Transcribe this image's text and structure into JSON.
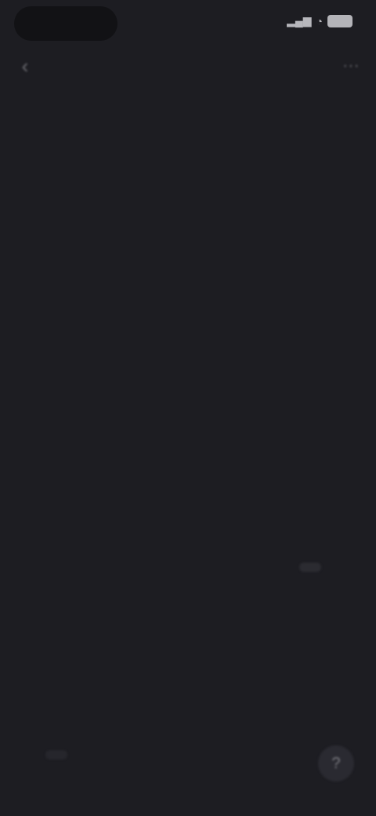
{
  "status": {
    "time": "",
    "signal_icon": "signal-icon",
    "wifi_icon": "wifi-icon",
    "battery_icon": "battery-icon"
  },
  "nav": {
    "back_icon": "back-arrow-icon",
    "right_icon": "more-icon"
  },
  "main": {
    "title": "",
    "paragraphs": [
      "",
      "",
      "",
      ""
    ],
    "link_prefix": "",
    "link_label": ""
  },
  "bottom": {
    "note": "",
    "action_1": "",
    "action_2": "",
    "fab_icon": "help-icon"
  },
  "colors": {
    "background": "#1d1d22",
    "title": "#e9e9ee",
    "body_text": "#8c8c92",
    "pill_bg": "#2b2b31"
  }
}
